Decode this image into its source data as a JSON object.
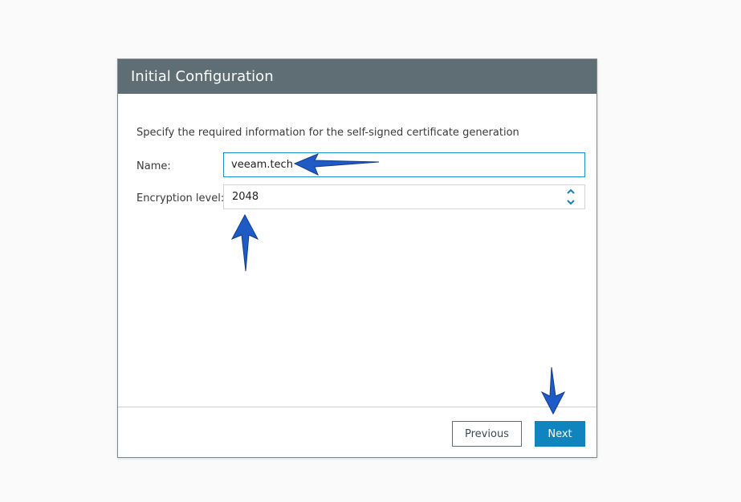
{
  "dialog": {
    "title": "Initial Configuration",
    "description": "Specify the required information for the self-signed certificate generation"
  },
  "form": {
    "name_label": "Name:",
    "name_value": "veeam.tech",
    "encryption_label": "Encryption level:",
    "encryption_value": "2048"
  },
  "buttons": {
    "previous": "Previous",
    "next": "Next"
  },
  "colors": {
    "header_bg": "#5f6d74",
    "accent": "#0f84bd",
    "annotation_arrow": "#1e5bc6"
  },
  "icons": {
    "spin_up": "chevron-up-icon",
    "spin_down": "chevron-down-icon",
    "annotation": "arrow-annotation"
  }
}
